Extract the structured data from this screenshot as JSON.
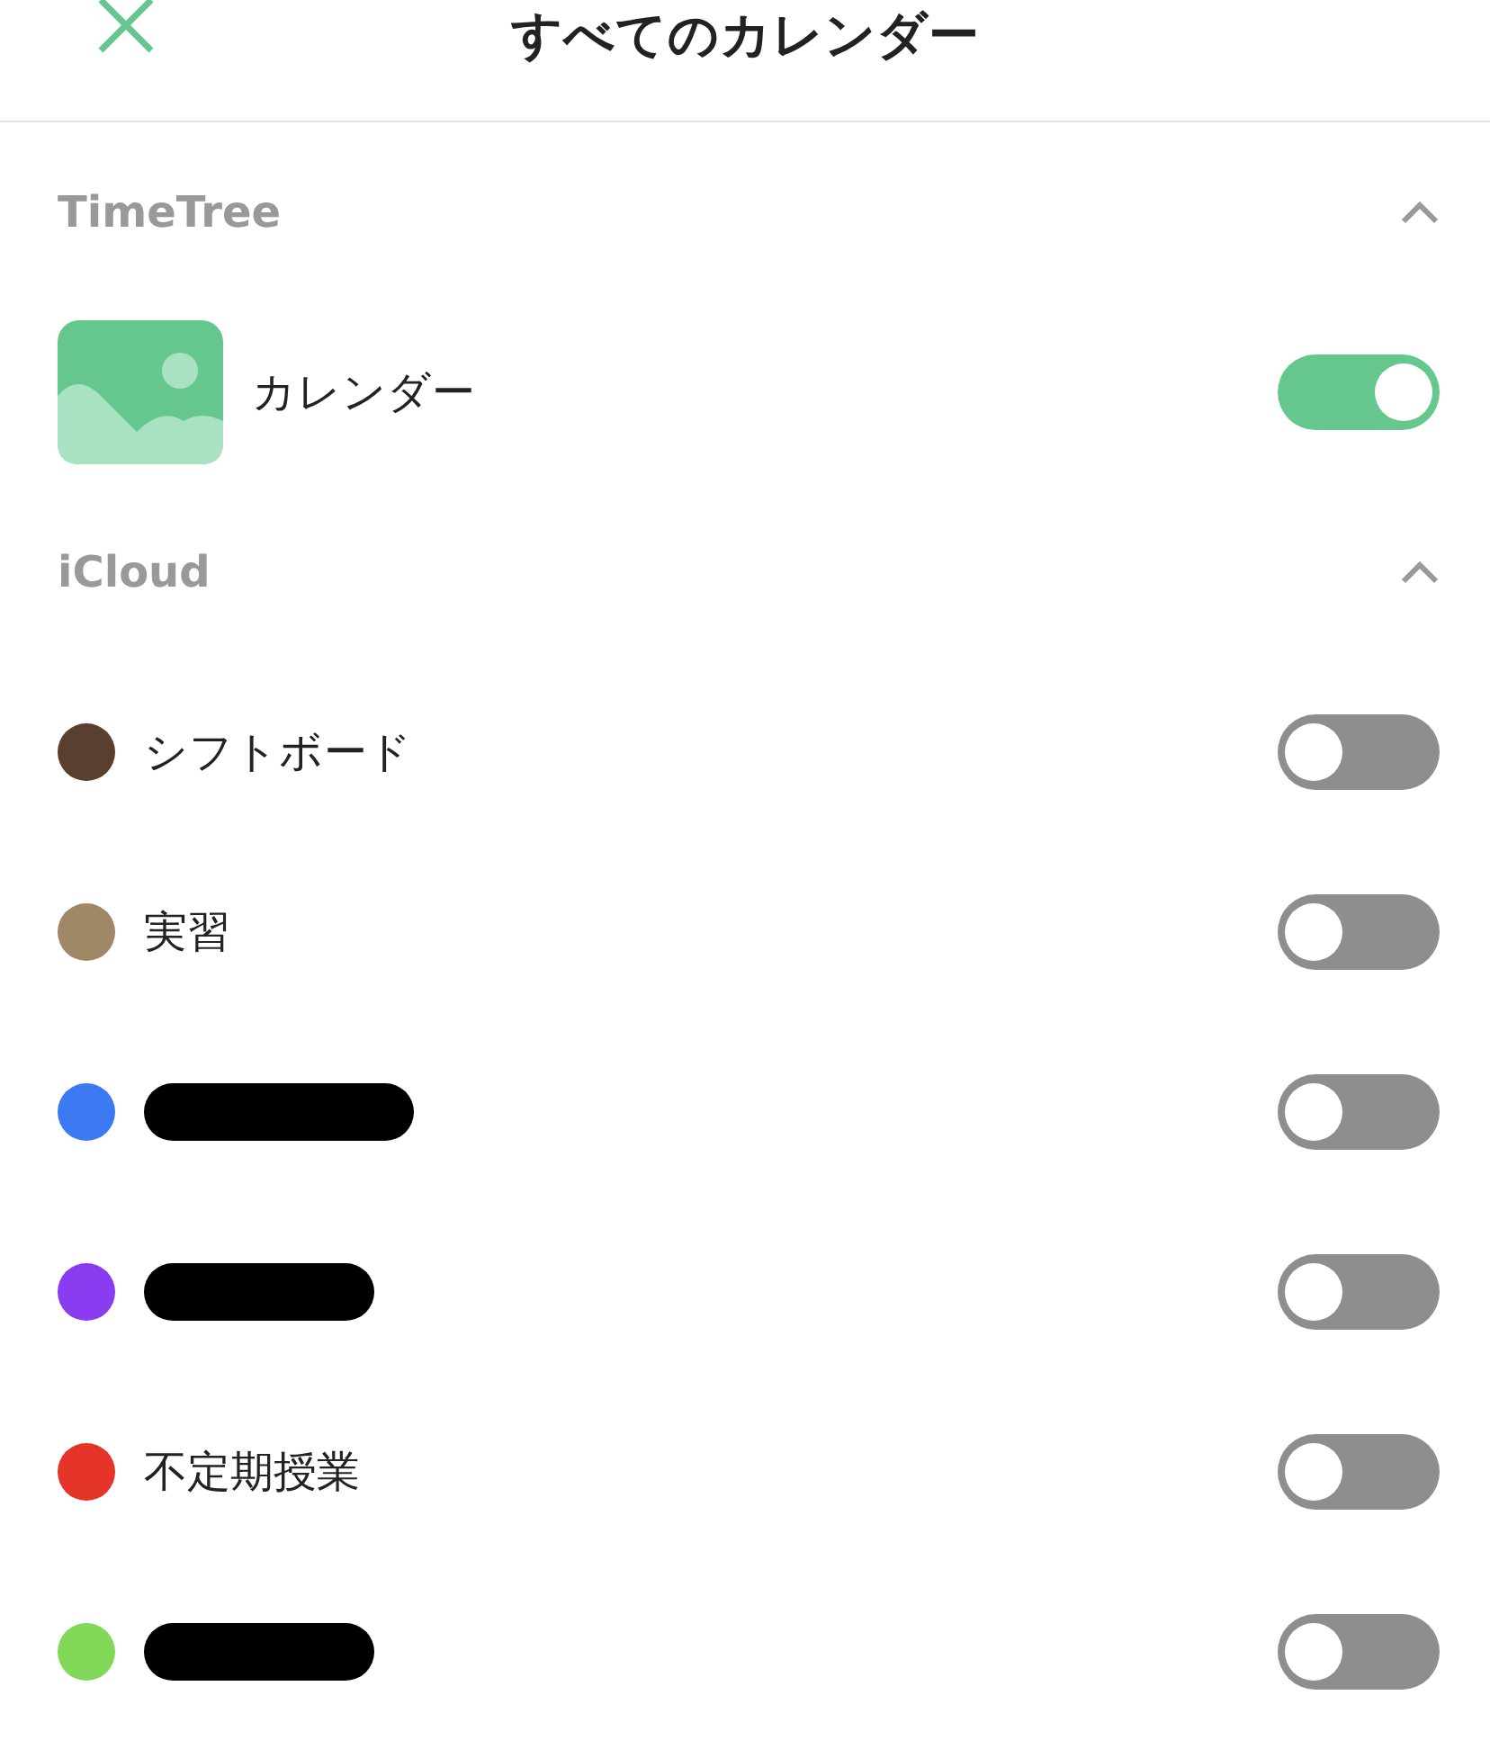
{
  "header": {
    "title": "すべてのカレンダー"
  },
  "sections": [
    {
      "title": "TimeTree",
      "expanded": true,
      "items": [
        {
          "kind": "app",
          "label": "カレンダー",
          "on": true
        }
      ]
    },
    {
      "title": "iCloud",
      "expanded": true,
      "items": [
        {
          "kind": "dot",
          "color": "#5a3e2e",
          "label": "シフトボード",
          "on": false
        },
        {
          "kind": "dot",
          "color": "#a08866",
          "label": "実習",
          "on": false
        },
        {
          "kind": "dot",
          "color": "#3b7af2",
          "redacted": true,
          "on": false
        },
        {
          "kind": "dot",
          "color": "#8a3df0",
          "redacted": true,
          "on": false
        },
        {
          "kind": "dot",
          "color": "#e5342a",
          "label": "不定期授業",
          "on": false
        },
        {
          "kind": "dot",
          "color": "#82d858",
          "redacted": true,
          "on": false
        }
      ]
    }
  ]
}
